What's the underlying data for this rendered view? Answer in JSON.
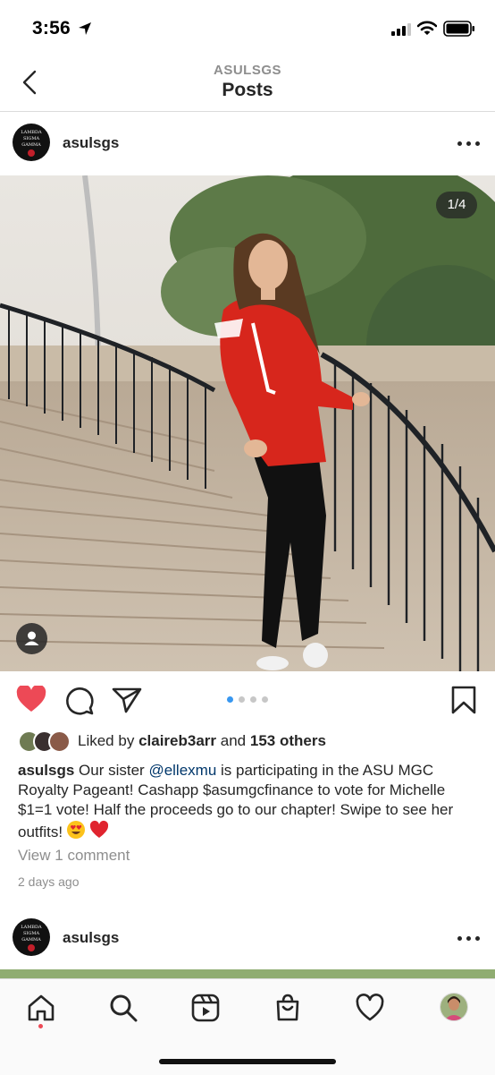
{
  "status_bar": {
    "time": "3:56"
  },
  "header": {
    "account_label": "ASULSGS",
    "title": "Posts"
  },
  "avatar_text": {
    "line1": "LAMBDA",
    "line2": "SIGMA",
    "line3": "GAMMA"
  },
  "post": {
    "username": "asulsgs",
    "image_counter": "1/4",
    "carousel": {
      "count": 4,
      "active_index": 0
    },
    "liked_state": true,
    "likes": {
      "prefix": "Liked by",
      "user": "claireb3arr",
      "joiner": "and",
      "others": "153 others"
    },
    "caption": {
      "username": "asulsgs",
      "text_before": " Our sister ",
      "mention": "@ellexmu",
      "text_after": " is participating in the ASU MGC Royalty Pageant! Cashapp $asumgcfinance to vote for Michelle $1=1 vote! Half the proceeds go to our chapter! Swipe to see her outfits!"
    },
    "view_comments": "View 1 comment",
    "posted_ago": "2 days ago"
  },
  "next_post": {
    "username": "asulsgs"
  },
  "tabbar": {
    "active": "home",
    "icons": [
      "home-icon",
      "search-icon",
      "reels-icon",
      "shop-icon",
      "activity-heart-icon",
      "profile-avatar"
    ]
  },
  "colors": {
    "like_red": "#ed4956",
    "active_dot": "#3897f0",
    "mention": "#00376b",
    "secondary_text": "#8e8e8e"
  }
}
